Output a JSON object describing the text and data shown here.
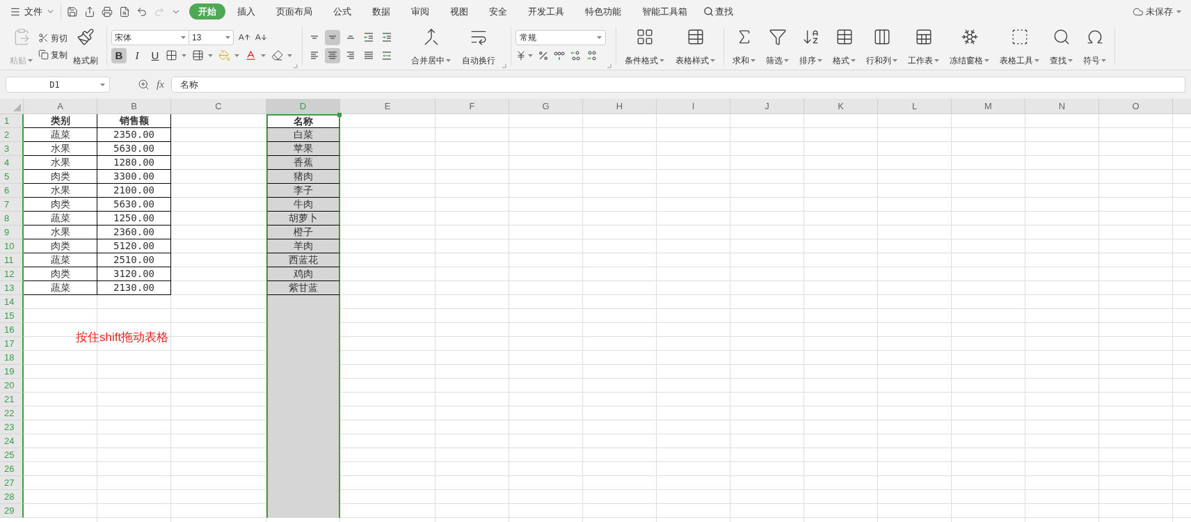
{
  "menu_bar": {
    "file_menu": "文件",
    "tabs": [
      {
        "label": "开始",
        "selected": true
      },
      {
        "label": "插入",
        "selected": false
      },
      {
        "label": "页面布局",
        "selected": false
      },
      {
        "label": "公式",
        "selected": false
      },
      {
        "label": "数据",
        "selected": false
      },
      {
        "label": "审阅",
        "selected": false
      },
      {
        "label": "视图",
        "selected": false
      },
      {
        "label": "安全",
        "selected": false
      },
      {
        "label": "开发工具",
        "selected": false
      },
      {
        "label": "特色功能",
        "selected": false
      },
      {
        "label": "智能工具箱",
        "selected": false
      }
    ],
    "search": "查找",
    "save_status": "未保存"
  },
  "ribbon": {
    "clipboard": [
      {
        "label": "粘贴",
        "kind": "paste",
        "disabled": true,
        "dropdown": true
      },
      {
        "label": "剪切",
        "kind": "cut",
        "disabled": false
      },
      {
        "label": "复制",
        "kind": "copy",
        "disabled": false
      },
      {
        "label": "格式刷",
        "kind": "painter",
        "disabled": false,
        "dropdown": false
      }
    ],
    "font": {
      "name": "宋体",
      "size": "13",
      "styles": [
        {
          "label": "B",
          "kind": "bold",
          "pressed": true
        },
        {
          "label": "I",
          "kind": "italic",
          "pressed": false
        },
        {
          "label": "U",
          "kind": "underline",
          "pressed": false
        }
      ]
    },
    "alignment": [
      {
        "kind": "top",
        "pressed": false
      },
      {
        "kind": "middle",
        "pressed": true
      },
      {
        "kind": "bottom",
        "pressed": false
      },
      {
        "kind": "outdent",
        "pressed": false
      },
      {
        "kind": "indent",
        "pressed": false
      },
      {
        "kind": "left",
        "pressed": false
      },
      {
        "kind": "center",
        "pressed": true
      },
      {
        "kind": "right",
        "pressed": false
      },
      {
        "kind": "justify",
        "pressed": false
      },
      {
        "kind": "distributed",
        "pressed": false
      }
    ],
    "alignment_buttons": [
      {
        "label": "合并居中",
        "kind": "merge",
        "dropdown": true
      },
      {
        "label": "自动换行",
        "kind": "wrap",
        "dropdown": false
      }
    ],
    "number_format": "常规",
    "style_buttons": [
      {
        "label": "条件格式",
        "kind": "conditional",
        "dropdown": true
      },
      {
        "label": "表格样式",
        "kind": "table-style",
        "dropdown": true
      }
    ],
    "commands": [
      {
        "label": "求和",
        "kind": "sum",
        "dropdown": true
      },
      {
        "label": "筛选",
        "kind": "filter",
        "dropdown": true
      },
      {
        "label": "排序",
        "kind": "sort",
        "dropdown": true
      },
      {
        "label": "格式",
        "kind": "format",
        "dropdown": true
      },
      {
        "label": "行和列",
        "kind": "rows-cols",
        "dropdown": true
      },
      {
        "label": "工作表",
        "kind": "sheet",
        "dropdown": true
      },
      {
        "label": "冻结窗格",
        "kind": "freeze",
        "dropdown": true
      },
      {
        "label": "表格工具",
        "kind": "tools",
        "dropdown": true
      },
      {
        "label": "查找",
        "kind": "find",
        "dropdown": true
      },
      {
        "label": "符号",
        "kind": "symbol",
        "dropdown": true
      }
    ]
  },
  "formula_bar": {
    "name_box": "D1",
    "fx": "fx",
    "formula": "名称"
  },
  "sheet": {
    "columns": [
      {
        "label": "A",
        "selected": false
      },
      {
        "label": "B",
        "selected": false
      },
      {
        "label": "C",
        "selected": false
      },
      {
        "label": "D",
        "selected": true
      },
      {
        "label": "E",
        "selected": false
      },
      {
        "label": "F",
        "selected": false
      },
      {
        "label": "G",
        "selected": false
      },
      {
        "label": "H",
        "selected": false
      },
      {
        "label": "I",
        "selected": false
      },
      {
        "label": "J",
        "selected": false
      },
      {
        "label": "K",
        "selected": false
      },
      {
        "label": "L",
        "selected": false
      },
      {
        "label": "M",
        "selected": false
      },
      {
        "label": "N",
        "selected": false
      },
      {
        "label": "O",
        "selected": false
      }
    ],
    "row_labels": [
      "1",
      "2",
      "3",
      "4",
      "5",
      "6",
      "7",
      "8",
      "9",
      "10",
      "11",
      "12",
      "13",
      "14",
      "15",
      "16",
      "17",
      "18",
      "19",
      "20",
      "21",
      "22",
      "23",
      "24",
      "25",
      "26",
      "27",
      "28",
      "29"
    ],
    "sales_table": {
      "header": [
        "类别",
        "销售额"
      ],
      "rows": [
        [
          "蔬菜",
          "2350.00"
        ],
        [
          "水果",
          "5630.00"
        ],
        [
          "水果",
          "1280.00"
        ],
        [
          "肉类",
          "3300.00"
        ],
        [
          "水果",
          "2100.00"
        ],
        [
          "肉类",
          "5630.00"
        ],
        [
          "蔬菜",
          "1250.00"
        ],
        [
          "水果",
          "2360.00"
        ],
        [
          "肉类",
          "5120.00"
        ],
        [
          "蔬菜",
          "2510.00"
        ],
        [
          "肉类",
          "3120.00"
        ],
        [
          "蔬菜",
          "2130.00"
        ]
      ]
    },
    "name_list": {
      "header": "名称",
      "items": [
        "白菜",
        "苹果",
        "香蕉",
        "猪肉",
        "李子",
        "牛肉",
        "胡萝卜",
        "橙子",
        "羊肉",
        "西蓝花",
        "鸡肉",
        "紫甘蓝"
      ]
    },
    "annotation": "按住shift拖动表格"
  }
}
